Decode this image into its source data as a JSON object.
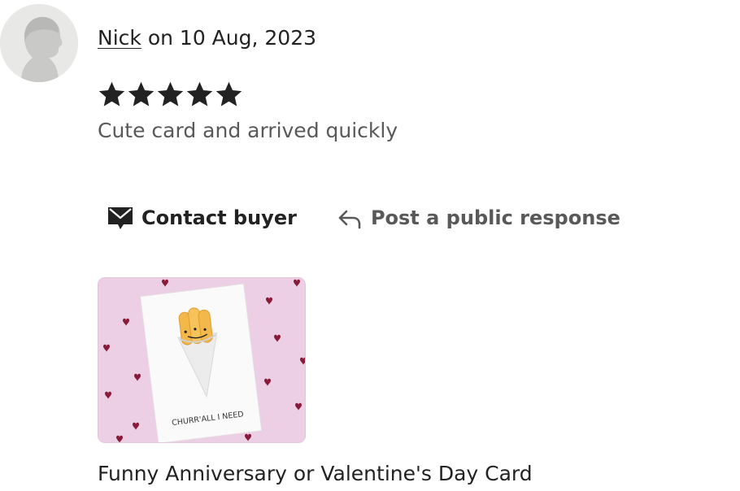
{
  "review": {
    "reviewer_name": "Nick",
    "date_text": "on 10 Aug, 2023",
    "rating": 5,
    "max_rating": 5,
    "text": "Cute card and arrived quickly"
  },
  "actions": {
    "contact_label": "Contact buyer",
    "respond_label": "Post a public response"
  },
  "product": {
    "card_text": "CHURR'ALL I NEED",
    "title": "Funny Anniversary or Valentine's Day Card"
  },
  "colors": {
    "text_primary": "#222222",
    "text_secondary": "#595959",
    "card_background_pink": "#eccfe4",
    "heart_red": "#8a1a3a"
  },
  "icons": {
    "avatar": "default-user-avatar",
    "star": "filled-star-icon",
    "contact": "envelope-icon",
    "respond": "reply-arrow-icon"
  }
}
